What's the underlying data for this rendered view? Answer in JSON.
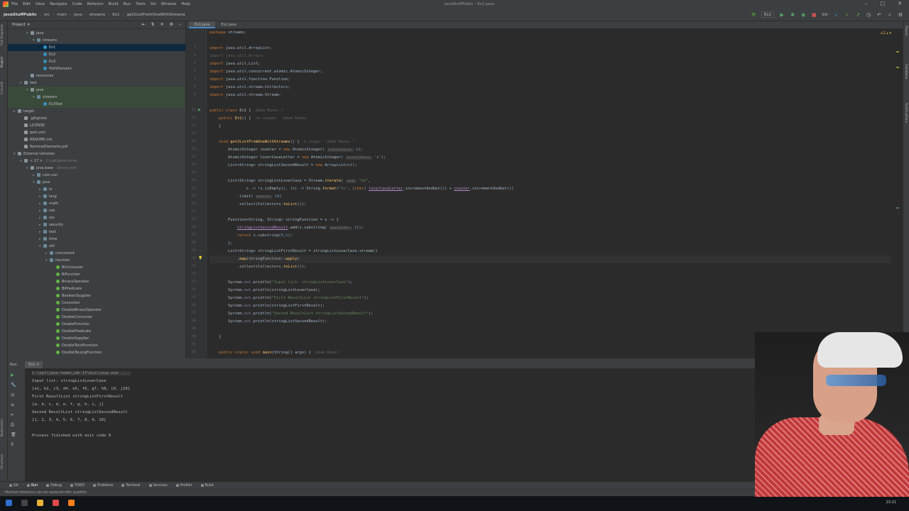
{
  "menubar": {
    "items": [
      "File",
      "Edit",
      "View",
      "Navigate",
      "Code",
      "Refactor",
      "Build",
      "Run",
      "Tools",
      "Git",
      "Window",
      "Help"
    ],
    "window_title": "javaStuffPublic - Ex1.java"
  },
  "navbar": {
    "crumbs": [
      "javaStuffPublic",
      "src",
      "main",
      "java",
      "streams",
      "Ex1",
      "get2ListFromOneWithStreams"
    ],
    "run_config": "Ex1",
    "git_label": "Git:"
  },
  "project_panel": {
    "title": "Project",
    "tree": [
      {
        "label": "java",
        "icon": "folder",
        "indent": 2,
        "arrow": "▾",
        "style": ""
      },
      {
        "label": "streams",
        "icon": "pkg",
        "indent": 3,
        "arrow": "▾",
        "style": ""
      },
      {
        "label": "Ex1",
        "icon": "cls",
        "indent": 4,
        "arrow": "",
        "style": "sel"
      },
      {
        "label": "Ex2",
        "icon": "cls",
        "indent": 4,
        "arrow": "",
        "style": ""
      },
      {
        "label": "Ex3",
        "icon": "cls",
        "indent": 4,
        "arrow": "",
        "style": ""
      },
      {
        "label": "PathElement",
        "icon": "cls",
        "indent": 4,
        "arrow": "",
        "style": ""
      },
      {
        "label": "resources",
        "icon": "folder",
        "indent": 2,
        "arrow": "",
        "style": ""
      },
      {
        "label": "test",
        "icon": "folder",
        "indent": 1,
        "arrow": "▾",
        "style": ""
      },
      {
        "label": "java",
        "icon": "folder",
        "indent": 2,
        "arrow": "▾",
        "style": "green"
      },
      {
        "label": "streams",
        "icon": "pkg",
        "indent": 3,
        "arrow": "▾",
        "style": "green"
      },
      {
        "label": "Ex3Test",
        "icon": "cls",
        "indent": 4,
        "arrow": "",
        "style": "green"
      },
      {
        "label": "target",
        "icon": "folder",
        "indent": 0,
        "arrow": "▸",
        "style": ""
      },
      {
        "label": ".gitignore",
        "icon": "file",
        "indent": 1,
        "arrow": "",
        "style": ""
      },
      {
        "label": "LICENSE",
        "icon": "file",
        "indent": 1,
        "arrow": "",
        "style": ""
      },
      {
        "label": "pom.xml",
        "icon": "file",
        "indent": 1,
        "arrow": "",
        "style": ""
      },
      {
        "label": "README.md",
        "icon": "file",
        "indent": 1,
        "arrow": "",
        "style": ""
      },
      {
        "label": "RemoveElements.pdf",
        "icon": "file",
        "indent": 1,
        "arrow": "",
        "style": ""
      },
      {
        "label": "External Libraries",
        "icon": "folder",
        "indent": 0,
        "arrow": "▾",
        "style": ""
      },
      {
        "label": "< 17 >",
        "icon": "folder",
        "indent": 1,
        "arrow": "▾",
        "style": "",
        "muted": "C:\\opt\\java-home..."
      },
      {
        "label": "java.base",
        "icon": "folder",
        "indent": 2,
        "arrow": "▾",
        "style": "",
        "muted": "library root"
      },
      {
        "label": "com.sun",
        "icon": "pkg",
        "indent": 3,
        "arrow": "▸",
        "style": ""
      },
      {
        "label": "java",
        "icon": "pkg",
        "indent": 3,
        "arrow": "▾",
        "style": ""
      },
      {
        "label": "io",
        "icon": "pkg",
        "indent": 4,
        "arrow": "▸",
        "style": ""
      },
      {
        "label": "lang",
        "icon": "pkg",
        "indent": 4,
        "arrow": "▸",
        "style": ""
      },
      {
        "label": "math",
        "icon": "pkg",
        "indent": 4,
        "arrow": "▸",
        "style": ""
      },
      {
        "label": "net",
        "icon": "pkg",
        "indent": 4,
        "arrow": "▸",
        "style": ""
      },
      {
        "label": "nio",
        "icon": "pkg",
        "indent": 4,
        "arrow": "▸",
        "style": ""
      },
      {
        "label": "security",
        "icon": "pkg",
        "indent": 4,
        "arrow": "▸",
        "style": ""
      },
      {
        "label": "text",
        "icon": "pkg",
        "indent": 4,
        "arrow": "▸",
        "style": ""
      },
      {
        "label": "time",
        "icon": "pkg",
        "indent": 4,
        "arrow": "▸",
        "style": ""
      },
      {
        "label": "util",
        "icon": "pkg",
        "indent": 4,
        "arrow": "▾",
        "style": ""
      },
      {
        "label": "concurrent",
        "icon": "pkg",
        "indent": 5,
        "arrow": "▸",
        "style": ""
      },
      {
        "label": "function",
        "icon": "pkg",
        "indent": 5,
        "arrow": "▾",
        "style": ""
      },
      {
        "label": "BiConsumer",
        "icon": "ifc",
        "indent": 6,
        "arrow": "",
        "style": ""
      },
      {
        "label": "BiFunction",
        "icon": "ifc",
        "indent": 6,
        "arrow": "",
        "style": ""
      },
      {
        "label": "BinaryOperator",
        "icon": "ifc",
        "indent": 6,
        "arrow": "",
        "style": ""
      },
      {
        "label": "BiPredicate",
        "icon": "ifc",
        "indent": 6,
        "arrow": "",
        "style": ""
      },
      {
        "label": "BooleanSupplier",
        "icon": "ifc",
        "indent": 6,
        "arrow": "",
        "style": ""
      },
      {
        "label": "Consumer",
        "icon": "ifc",
        "indent": 6,
        "arrow": "",
        "style": ""
      },
      {
        "label": "DoubleBinaryOperator",
        "icon": "ifc",
        "indent": 6,
        "arrow": "",
        "style": ""
      },
      {
        "label": "DoubleConsumer",
        "icon": "ifc",
        "indent": 6,
        "arrow": "",
        "style": ""
      },
      {
        "label": "DoubleFunction",
        "icon": "ifc",
        "indent": 6,
        "arrow": "",
        "style": ""
      },
      {
        "label": "DoublePredicate",
        "icon": "ifc",
        "indent": 6,
        "arrow": "",
        "style": ""
      },
      {
        "label": "DoubleSupplier",
        "icon": "ifc",
        "indent": 6,
        "arrow": "",
        "style": ""
      },
      {
        "label": "DoubleToIntFunction",
        "icon": "ifc",
        "indent": 6,
        "arrow": "",
        "style": ""
      },
      {
        "label": "DoubleToLongFunction",
        "icon": "ifc",
        "indent": 6,
        "arrow": "",
        "style": ""
      }
    ]
  },
  "editor": {
    "tabs": [
      "Ex1.java",
      "Ex2.java"
    ],
    "active_tab": 0,
    "warning_count": "2",
    "line_numbers": [
      "1",
      "",
      "3",
      "4",
      "5",
      "6",
      "7",
      "8",
      "9",
      "",
      "11",
      "12",
      "13",
      "14",
      "15",
      "16",
      "17",
      "18",
      "19",
      "20",
      "21",
      "22",
      "23",
      "24",
      "25",
      "26",
      "27",
      "28",
      "29",
      "30",
      "31",
      "32",
      "33",
      "34",
      "35",
      "36",
      "37",
      "38",
      "39",
      "40",
      "41",
      "42",
      "43"
    ],
    "lines": [
      {
        "html": "<span class='kw'>package</span> streams;"
      },
      {
        "html": ""
      },
      {
        "html": "<span class='kw'>import</span> java.util.ArrayList;"
      },
      {
        "html": "<span class='gr'>import java.util.Arrays;</span>"
      },
      {
        "html": "<span class='kw'>import</span> java.util.List;"
      },
      {
        "html": "<span class='kw'>import</span> java.util.concurrent.atomic.AtomicInteger;"
      },
      {
        "html": "<span class='kw'>import</span> java.util.function.Function;"
      },
      {
        "html": "<span class='kw'>import</span> java.util.stream.Collectors;"
      },
      {
        "html": "<span class='kw'>import</span> java.util.stream.Stream;"
      },
      {
        "html": ""
      },
      {
        "html": "<span class='kw'>public class</span> Ex1 {  <span class='dim'>Adam Banes *</span>"
      },
      {
        "html": "    <span class='kw'>public</span> <span class='fn'>Ex1</span>() {  <span class='dim'>no usages   Adam Banes</span>"
      },
      {
        "html": "    }"
      },
      {
        "html": ""
      },
      {
        "html": "    <span class='kw'>void</span> <span class='fn'>get2ListFromOneWithStreams</span>() {  <span class='dim'>1 usage   Adam Banes *</span>"
      },
      {
        "html": "        AtomicInteger counter = <span class='kw'>new</span> AtomicInteger( <span class='hint'>initialValue:</span> <span class='nm'>1</span>);"
      },
      {
        "html": "        AtomicInteger loverCaseLetter = <span class='kw'>new</span> AtomicInteger( <span class='hint'>initialValue:</span> <span class='st'>'a'</span>);"
      },
      {
        "html": "        List&lt;String&gt; stringListSecondResult = <span class='kw'>new</span> ArrayList&lt;&gt;();"
      },
      {
        "html": ""
      },
      {
        "html": "        List&lt;String&gt; stringListLoverCase = Stream.<span class='fn'>iterate</span>( <span class='hint'>seed:</span> <span class='st'>\"a1\"</span>,"
      },
      {
        "html": "                s -&gt; !s.isEmpty(), (s) -&gt; String.<span class='fn'>format</span>(<span class='st'>\"%s\"</span>, (<span class='kw'>char</span>) <span class='und'>loverCaseLetter</span>.incrementAndGet()) + <span class='und'>counter</span>.incrementAndGet())"
      },
      {
        "html": "            .limit( <span class='hint'>maxSize:</span> <span class='nm'>10</span>)"
      },
      {
        "html": "            .collect(Collectors.<span class='fn'>toList</span>());"
      },
      {
        "html": ""
      },
      {
        "html": "        Function&lt;String, String&gt; stringFunction = s -&gt; {"
      },
      {
        "html": "            <span class='und'>stringListSecondResult</span>.add(s.substring( <span class='hint'>beginIndex:</span> <span class='nm'>1</span>));"
      },
      {
        "html": "            <span class='kw'>return</span> s.substring(<span class='nm'>0</span>,<span class='nm'>1</span>);"
      },
      {
        "html": "        };"
      },
      {
        "html": "        List&lt;String&gt; stringListFirstResult = stringListLoverCase.stream()"
      },
      {
        "html": "            .<span class='fn'>map</span>(stringFunction::<span class='fn'>apply</span>)"
      },
      {
        "html": "            .collect(Collectors.<span class='fn'>toList</span>());"
      },
      {
        "html": ""
      },
      {
        "html": "        System.<span class='fld'>out</span>.println(<span class='st'>\"Input list: stringListLoverCase\"</span>);"
      },
      {
        "html": "        System.<span class='fld'>out</span>.println(stringListLoverCase);"
      },
      {
        "html": "        System.<span class='fld'>out</span>.println(<span class='st'>\"First ResultList stringListFirstResult\"</span>);"
      },
      {
        "html": "        System.<span class='fld'>out</span>.println(stringListFirstResult);"
      },
      {
        "html": "        System.<span class='fld'>out</span>.println(<span class='st'>\"Second ResultList stringListSecondResult\"</span>);"
      },
      {
        "html": "        System.<span class='fld'>out</span>.println(stringListSecondResult);"
      },
      {
        "html": ""
      },
      {
        "html": "    }"
      },
      {
        "html": ""
      },
      {
        "html": "    <span class='kw'>public static void</span> <span class='fn'>main</span>(String[] args) {  <span class='dim'>Adam Banes</span>"
      }
    ]
  },
  "run_panel": {
    "label": "Run:",
    "tab": "Ex1",
    "command": "C:\\opt\\java-home\\jdk-17\\bin\\java.exe ...",
    "output": [
      "Input list: stringListLoverCase",
      "[a1, b2, c3, d4, e5, f6, g7, h8, i9, j10]",
      "First ResultList stringListFirstResult",
      "[a, b, c, d, e, f, g, h, i, j]",
      "Second ResultList stringListSecondResult",
      "[1, 2, 3, 4, 5, 6, 7, 8, 9, 10]",
      "",
      "Process finished with exit code 0"
    ]
  },
  "tool_windows": [
    "Git",
    "Run",
    "Debug",
    "TODO",
    "Problems",
    "Terminal",
    "Services",
    "Profiler",
    "Build"
  ],
  "statusbar": {
    "message": "Method reference can be replaced with qualifier"
  },
  "taskbar": {
    "clock": "23:21"
  },
  "colors": {
    "background": "#2b2b2b",
    "panel": "#3c3f41",
    "keyword": "#cc7832",
    "string": "#6a8759",
    "function": "#ffc66d",
    "selection": "#0d293e"
  }
}
